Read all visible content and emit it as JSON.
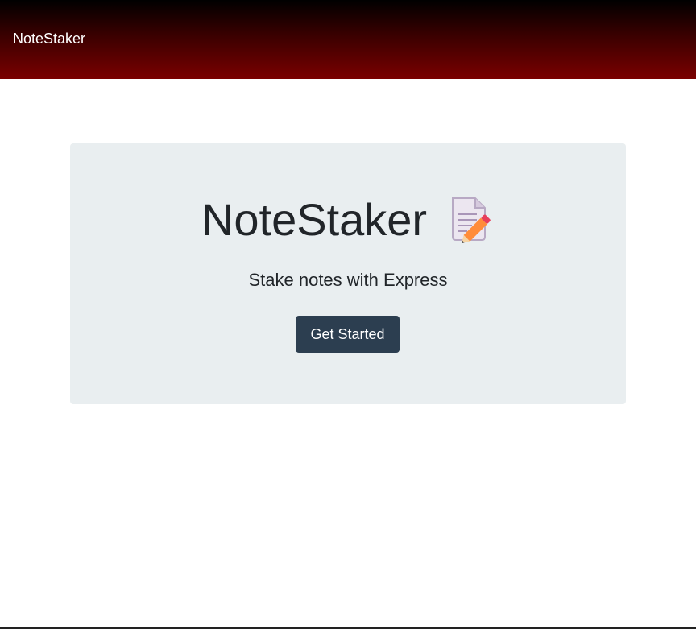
{
  "navbar": {
    "brand": "NoteStaker"
  },
  "hero": {
    "title": "NoteStaker",
    "icon": "memo-pencil-icon",
    "subtitle": "Stake notes with Express",
    "cta_label": "Get Started"
  },
  "colors": {
    "navbar_gradient_start": "#000000",
    "navbar_gradient_end": "#7a0000",
    "jumbotron_bg": "#e9eef0",
    "button_bg": "#2c3e50",
    "text": "#212529"
  }
}
